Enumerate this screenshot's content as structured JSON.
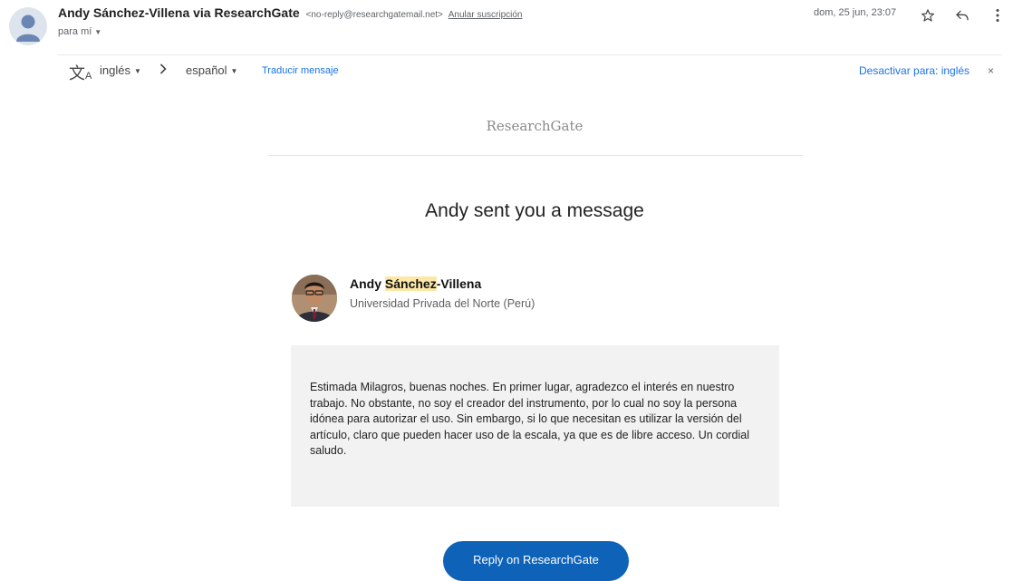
{
  "header": {
    "sender_name": "Andy Sánchez-Villena via ResearchGate",
    "sender_email": "<no-reply@researchgatemail.net>",
    "unsubscribe_label": "Anular suscripción",
    "recipient_label": "para mí",
    "date": "dom, 25 jun, 23:07",
    "icons": [
      "star-icon",
      "reply-icon",
      "more-vert-icon"
    ]
  },
  "translate_bar": {
    "from_lang": "inglés",
    "to_lang": "español",
    "translate_label": "Traducir mensaje",
    "deactivate_label": "Desactivar para: inglés",
    "close_glyph": "×"
  },
  "email": {
    "logo_text": "ResearchGate",
    "headline": "Andy sent you a message",
    "sender": {
      "name_first": "Andy",
      "name_highlight": "Sánchez",
      "name_rest": "-Villena",
      "affiliation": "Universidad Privada del Norte (Perú)"
    },
    "message": "Estimada Milagros, buenas noches. En primer lugar, agradezco el interés en nuestro trabajo. No obstante, no soy el creador del instrumento, por lo cual no soy la persona idónea para autorizar el uso. Sin embargo, si lo que necesitan es utilizar la versión del artículo, claro que pueden hacer uso de la escala, ya que es de libre acceso. Un cordial saludo.",
    "reply_button": "Reply on ResearchGate"
  },
  "colors": {
    "link": "#1a73e8",
    "reply_button_bg": "#0e63b9",
    "highlight": "#fce8a6",
    "message_bg": "#f2f2f2"
  }
}
